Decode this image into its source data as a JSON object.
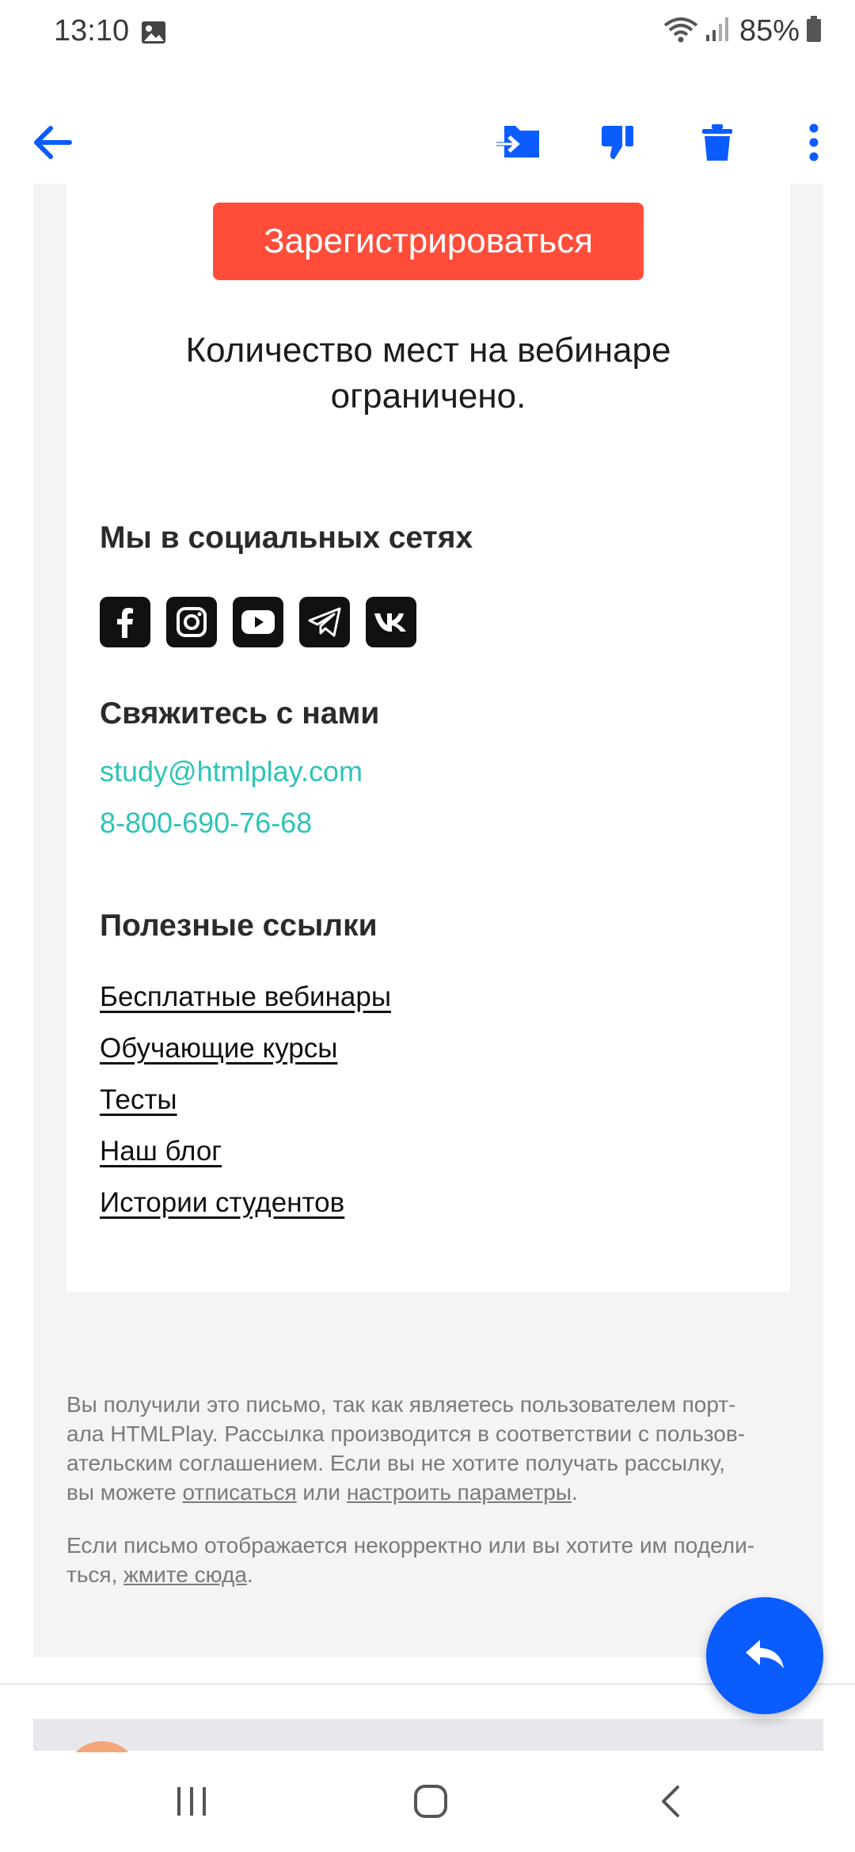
{
  "status_bar": {
    "time": "13:10",
    "battery": "85%",
    "icons": [
      "image-icon",
      "wifi-icon",
      "signal-icon",
      "battery-icon"
    ]
  },
  "toolbar": {
    "icons": [
      "back-arrow-icon",
      "move-to-folder-icon",
      "thumbs-down-icon",
      "trash-icon",
      "more-vert-icon"
    ],
    "accent": "#0b5cff"
  },
  "email": {
    "cta_label": "Зарегистрироваться",
    "limited_notice": "Количество мест на вебинаре ограничено.",
    "social_heading": "Мы в социальных сетях",
    "social_networks": [
      "facebook-icon",
      "instagram-icon",
      "youtube-icon",
      "telegram-icon",
      "vk-icon"
    ],
    "contact_heading": "Свяжитесь с нами",
    "contact_email": "study@htmlplay.com",
    "contact_phone": "8-800-690-76-68",
    "links_heading": "Полезные ссылки",
    "links": [
      "Бесплатные вебинары",
      "Обучающие курсы",
      "Тесты",
      "Наш блог",
      "Истории студентов"
    ],
    "footer": {
      "p1_line1": "Вы получили это письмо, так как являетесь пользователем порт-",
      "p1_line2": "ала HTMLPlay. Рассылка производится в соответствии с пользов-",
      "p1_line3": "ательским соглашением. Если вы не хотите получать рассылку,",
      "p1_line4_before": "вы можете ",
      "unsubscribe": "отписаться",
      "p1_line4_middle": " или ",
      "settings": "настроить параметры",
      "p1_line4_end": ".",
      "p2_line1": "Если письмо отображается некорректно или вы хотите им подели-",
      "p2_line2_before": "ться, ",
      "click_here": "жмите сюда",
      "p2_line2_end": "."
    },
    "colors": {
      "cta": "#ff4d3a",
      "contact_link": "#2ec4b6",
      "fab": "#0b5cff"
    }
  },
  "fab": {
    "icon": "reply-icon"
  },
  "nav_bar": {
    "icons": [
      "recent-apps-icon",
      "home-icon",
      "back-icon"
    ]
  }
}
